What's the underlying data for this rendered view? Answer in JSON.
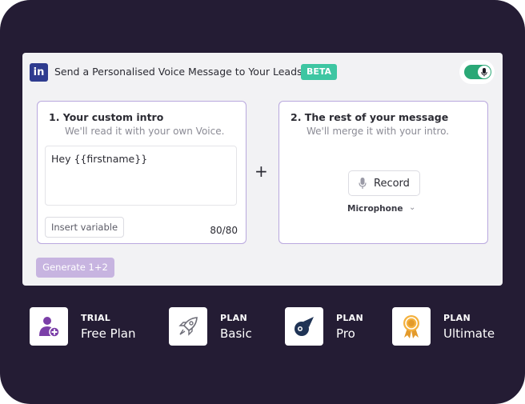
{
  "header": {
    "title": "Send a Personalised Voice Message to Your Leads",
    "badge": "BETA",
    "logo_text": "in",
    "toggle_state": "on"
  },
  "intro": {
    "title": "1. Your custom intro",
    "subtitle": "We'll read it with your own Voice.",
    "text": "Hey {{firstname}}",
    "insert_label": "Insert variable",
    "counter": "80/80"
  },
  "plus": "+",
  "rest": {
    "title": "2. The rest of your message",
    "subtitle": "We'll merge it with your intro.",
    "record_label": "Record",
    "microphone_label": "Microphone"
  },
  "generate_label": "Generate 1+2",
  "plans": [
    {
      "tier": "TRIAL",
      "name": "Free Plan",
      "icon": "add-user-icon"
    },
    {
      "tier": "PLAN",
      "name": "Basic",
      "icon": "rocket-icon"
    },
    {
      "tier": "PLAN",
      "name": "Pro",
      "icon": "comet-icon"
    },
    {
      "tier": "PLAN",
      "name": "Ultimate",
      "icon": "award-ribbon-icon"
    }
  ],
  "colors": {
    "background": "#241c34",
    "accent_purple": "#7b3fa8",
    "toggle_green": "#2aa876",
    "beta_green": "#3ec6a2",
    "linkedin_blue": "#2f3c8f"
  }
}
